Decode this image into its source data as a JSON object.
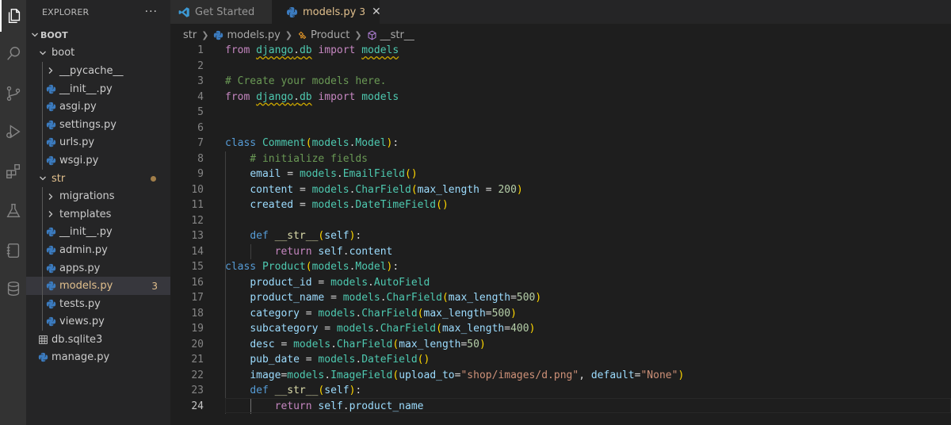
{
  "explorer": {
    "title": "EXPLORER",
    "more": "···",
    "root": "BOOT",
    "items": [
      {
        "label": "boot",
        "type": "folder-open",
        "depth": 1
      },
      {
        "label": "__pycache__",
        "type": "folder-closed",
        "depth": 2
      },
      {
        "label": "__init__.py",
        "type": "py",
        "depth": 2
      },
      {
        "label": "asgi.py",
        "type": "py",
        "depth": 2
      },
      {
        "label": "settings.py",
        "type": "py",
        "depth": 2
      },
      {
        "label": "urls.py",
        "type": "py",
        "depth": 2
      },
      {
        "label": "wsgi.py",
        "type": "py",
        "depth": 2
      },
      {
        "label": "str",
        "type": "folder-open",
        "depth": 1
      },
      {
        "label": "migrations",
        "type": "folder-closed",
        "depth": 2
      },
      {
        "label": "templates",
        "type": "folder-closed",
        "depth": 2
      },
      {
        "label": "__init__.py",
        "type": "py",
        "depth": 2
      },
      {
        "label": "admin.py",
        "type": "py",
        "depth": 2
      },
      {
        "label": "apps.py",
        "type": "py",
        "depth": 2
      },
      {
        "label": "models.py",
        "type": "py",
        "depth": 2,
        "problems": "3"
      },
      {
        "label": "tests.py",
        "type": "py",
        "depth": 2
      },
      {
        "label": "views.py",
        "type": "py",
        "depth": 2
      },
      {
        "label": "db.sqlite3",
        "type": "db",
        "depth": 1
      },
      {
        "label": "manage.py",
        "type": "py",
        "depth": 1
      }
    ]
  },
  "tabs": [
    {
      "label": "Get Started",
      "active": false
    },
    {
      "label": "models.py",
      "active": true,
      "problems": "3",
      "close": "✕"
    }
  ],
  "breadcrumb": [
    "str",
    "models.py",
    "Product",
    "__str__"
  ],
  "line_numbers": [
    "1",
    "2",
    "3",
    "4",
    "5",
    "6",
    "7",
    "8",
    "9",
    "10",
    "11",
    "12",
    "13",
    "14",
    "15",
    "16",
    "17",
    "18",
    "19",
    "20",
    "21",
    "22",
    "23",
    "24"
  ],
  "code_lines": [
    "from django.db import models",
    "",
    "# Create your models here.",
    "from django.db import models",
    "",
    "",
    "class Comment(models.Model):",
    "    # initialize fields",
    "    email = models.EmailField()",
    "    content = models.CharField(max_length = 200)",
    "    created = models.DateTimeField()",
    "",
    "    def __str__(self):",
    "        return self.content",
    "class Product(models.Model):",
    "    product_id = models.AutoField",
    "    product_name = models.CharField(max_length=500)",
    "    category = models.CharField(max_length=500)",
    "    subcategory = models.CharField(max_length=400)",
    "    desc = models.CharField(max_length=50)",
    "    pub_date = models.DateField()",
    "    image=models.ImageField(upload_to=\"shop/images/d.png\", default=\"None\")",
    "    def __str__(self):",
    "        return self.product_name"
  ],
  "current_line": 24,
  "colors": {
    "accent": "#0078d4",
    "modified": "#e2c08d",
    "python": "#3b7bbf"
  }
}
